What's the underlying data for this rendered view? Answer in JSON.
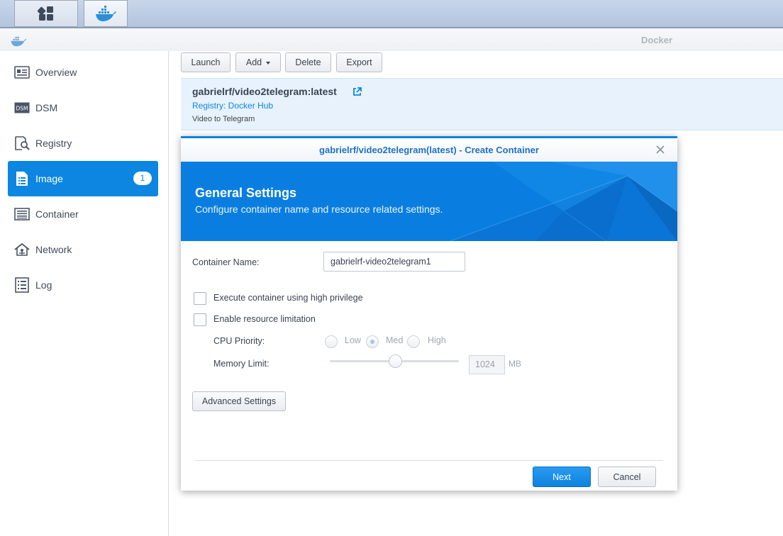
{
  "taskbar": {
    "buttons": [
      {
        "icon": "main-menu-grid-icon"
      },
      {
        "icon": "docker-whale-icon"
      }
    ]
  },
  "window": {
    "title": "Docker",
    "icon": "docker-whale-icon"
  },
  "sidebar": {
    "items": [
      {
        "label": "Overview",
        "icon": "overview-icon"
      },
      {
        "label": "DSM",
        "icon": "dsm-icon"
      },
      {
        "label": "Registry",
        "icon": "registry-search-icon"
      },
      {
        "label": "Image",
        "icon": "image-icon",
        "active": true,
        "badge": "1"
      },
      {
        "label": "Container",
        "icon": "container-icon"
      },
      {
        "label": "Network",
        "icon": "network-icon"
      },
      {
        "label": "Log",
        "icon": "log-icon"
      }
    ]
  },
  "toolbar": {
    "launch": "Launch",
    "add": "Add",
    "delete": "Delete",
    "export": "Export"
  },
  "image": {
    "name": "gabrielrf/video2telegram:latest",
    "registry": "Registry: Docker Hub",
    "description": "Video to Telegram"
  },
  "dialog": {
    "title": "gabrielrf/video2telegram(latest) - Create Container",
    "banner_title": "General Settings",
    "banner_subtitle": "Configure container name and resource related settings.",
    "container_name_label": "Container Name:",
    "container_name_value": "gabrielrf-video2telegram1",
    "high_privilege_label": "Execute container using high privilege",
    "resource_limit_label": "Enable resource limitation",
    "cpu_priority_label": "CPU Priority:",
    "cpu_options": [
      "Low",
      "Med",
      "High"
    ],
    "cpu_selected": "Med",
    "memory_limit_label": "Memory Limit:",
    "memory_value": "1024",
    "memory_unit": "MB",
    "advanced_settings": "Advanced Settings",
    "next": "Next",
    "cancel": "Cancel"
  },
  "colors": {
    "accent": "#0c86e0",
    "banner": "#0a7ee0",
    "active_nav": "#0c86e0"
  }
}
